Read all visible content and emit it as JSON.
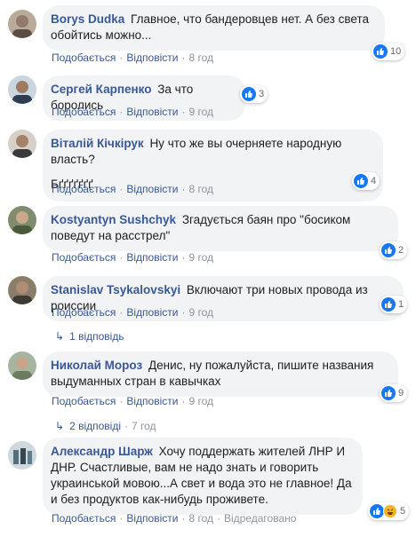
{
  "actions": {
    "like": "Подобається",
    "reply": "Відповісти",
    "separator": "·"
  },
  "comments": [
    {
      "name": "Borys Dudka",
      "text": "Главное, что бандеровцев нет. А без света обойтись можно...",
      "time": "8 год",
      "reactions": "10"
    },
    {
      "name": "Сергей Карпенко",
      "text": "За что боролись",
      "time": "9 год",
      "reactions": "3"
    },
    {
      "name": "Віталій Кічкірук",
      "text": "Ну что же вы очерняете народную власть?",
      "text2": "Бґґґґґґґ",
      "time": "8 год",
      "reactions": "4"
    },
    {
      "name": "Kostyantyn Sushchyk",
      "text": "Згадується баян про \"босиком поведут на расстрел\"",
      "time": "9 год",
      "reactions": "2"
    },
    {
      "name": "Stanislav Tsykalovskyi",
      "text": "Включают три новых провода из роиссии",
      "time": "9 год",
      "reactions": "1",
      "replies": "1 відповідь"
    },
    {
      "name": "Николай Мороз",
      "text": "Денис, ну пожалуйста, пишите названия выдуманных стран в кавычках",
      "time": "9 год",
      "reactions": "9",
      "replies": "2 відповіді",
      "replies_time": "7 год"
    },
    {
      "name": "Александр Шарж",
      "text": "Хочу поддержать жителей ЛНР И ДНР. Счастливые, вам не надо знать и говорить украинськой мовою...А свет и вода это не главное! Да и без продуктов как-нибудь проживете.",
      "time": "8 год",
      "edited": "Відредаговано",
      "reactions": "5"
    }
  ],
  "colors": {
    "link": "#385898",
    "like": "#1877f2",
    "bubble": "#f2f3f5",
    "meta": "#90949c"
  }
}
